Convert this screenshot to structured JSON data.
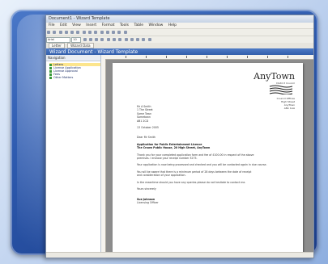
{
  "window": {
    "title": "Document1 - Wizard Template",
    "menu": [
      "File",
      "Edit",
      "View",
      "Insert",
      "Format",
      "Tools",
      "Table",
      "Window",
      "Help"
    ],
    "font_name": "Arial",
    "font_size": "10",
    "tab_labels": [
      "Letter",
      "Wizard Data"
    ]
  },
  "document_header": {
    "title": "Wizard Document - Wizard Template"
  },
  "navigation": {
    "header": "Navigation",
    "items": [
      {
        "label": "Letters"
      },
      {
        "label": "License Application"
      },
      {
        "label": "License Approval"
      },
      {
        "label": "Fees"
      },
      {
        "label": "Other Matters"
      }
    ]
  },
  "letter": {
    "brand": "AnyTown",
    "brand_sub": "District Council",
    "address": [
      "Council Offices",
      "High Street",
      "AnyTown",
      "AN1 1AA"
    ],
    "recipient": [
      "Mr A Smith",
      "1 The Street",
      "Some Town",
      "Sometown",
      "AB1 2CD"
    ],
    "date": "13 October 2005",
    "salutation": "Dear Mr Smith",
    "subject_line1": "Application for Public Entertainment Licence",
    "subject_line2": "The Crown Public House, 20 High Street, AnyTown",
    "para1": [
      "Thank you for your completed application form and fee of £100.00 in respect of the above",
      "premises. I enclose your receipt number 3275."
    ],
    "para2": "Your application is now being processed and checked and you will be contacted again in due course.",
    "para3": [
      "You will be aware that there is a minimum period of 28 days between the date of receipt",
      "and consideration of your application."
    ],
    "para4": "In the meantime should you have any queries please do not hesitate to contact me.",
    "closing": "Yours sincerely",
    "signature_name": "Sue Johnson",
    "signature_title": "Licensing Officer"
  }
}
